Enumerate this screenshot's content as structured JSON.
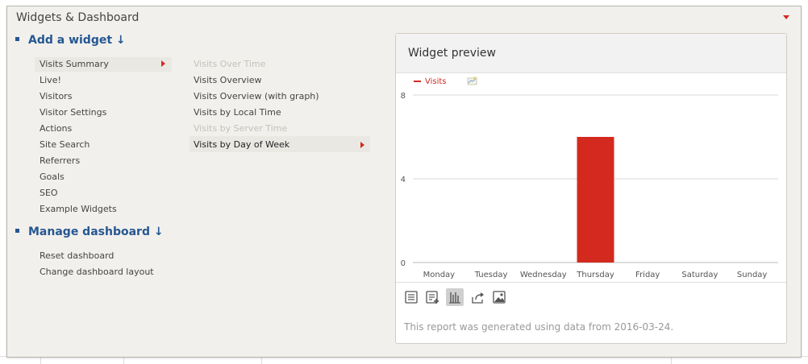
{
  "panel": {
    "title": "Widgets & Dashboard"
  },
  "add_widget": {
    "heading": "Add a widget ↓",
    "categories": [
      "Visits Summary",
      "Live!",
      "Visitors",
      "Visitor Settings",
      "Actions",
      "Site Search",
      "Referrers",
      "Goals",
      "SEO",
      "Example Widgets"
    ],
    "active_category": "Visits Summary",
    "subitems": [
      {
        "label": "Visits Over Time",
        "disabled": true
      },
      {
        "label": "Visits Overview",
        "disabled": false
      },
      {
        "label": "Visits Overview (with graph)",
        "disabled": false
      },
      {
        "label": "Visits by Local Time",
        "disabled": false
      },
      {
        "label": "Visits by Server Time",
        "disabled": true
      },
      {
        "label": "Visits by Day of Week",
        "disabled": false,
        "active": true
      }
    ]
  },
  "manage_dashboard": {
    "heading": "Manage dashboard ↓",
    "items": [
      "Reset dashboard",
      "Change dashboard layout"
    ]
  },
  "preview": {
    "title": "Widget preview",
    "footnote": "This report was generated using data from 2016-03-24.",
    "viz_buttons": [
      "table-icon",
      "table-more-icon",
      "bar-chart-icon",
      "export-icon",
      "image-icon"
    ],
    "active_viz": "bar-chart-icon"
  },
  "colors": {
    "accent": "#d4291f",
    "heading": "#255792",
    "panel_bg": "#f2f0ec"
  },
  "chart_data": {
    "type": "bar",
    "categories": [
      "Monday",
      "Tuesday",
      "Wednesday",
      "Thursday",
      "Friday",
      "Saturday",
      "Sunday"
    ],
    "series": [
      {
        "name": "Visits",
        "values": [
          0,
          0,
          0,
          6,
          0,
          0,
          0
        ],
        "color": "#d4291f"
      }
    ],
    "yticks": [
      0,
      4,
      8
    ],
    "ylim": [
      0,
      8
    ],
    "grid": true,
    "legend": "top-left"
  }
}
